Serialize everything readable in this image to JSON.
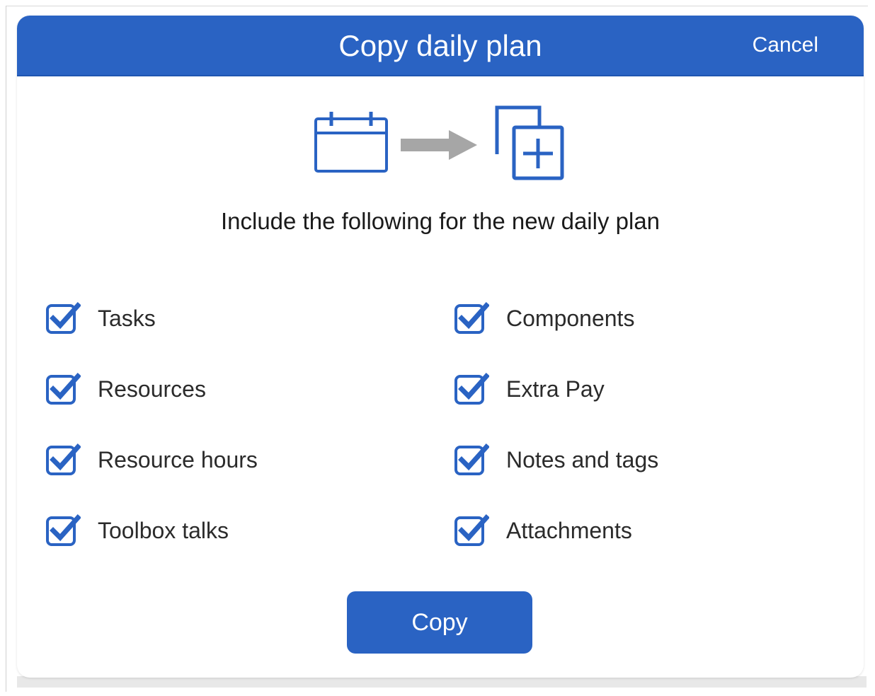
{
  "dialog": {
    "title": "Copy daily plan",
    "cancel_label": "Cancel",
    "prompt": "Include the following for the new daily plan",
    "copy_label": "Copy",
    "icons": [
      "calendar-icon",
      "arrow-right-icon",
      "copy-add-icon"
    ],
    "options_left": [
      {
        "label": "Tasks",
        "checked": true
      },
      {
        "label": "Resources",
        "checked": true
      },
      {
        "label": "Resource hours",
        "checked": true
      },
      {
        "label": "Toolbox talks",
        "checked": true
      }
    ],
    "options_right": [
      {
        "label": "Components",
        "checked": true
      },
      {
        "label": "Extra Pay",
        "checked": true
      },
      {
        "label": "Notes and tags",
        "checked": true
      },
      {
        "label": "Attachments",
        "checked": true
      }
    ]
  },
  "colors": {
    "accent": "#2a63c3",
    "checkbox": "#2a63c3",
    "arrow": "#a6a6a6"
  }
}
